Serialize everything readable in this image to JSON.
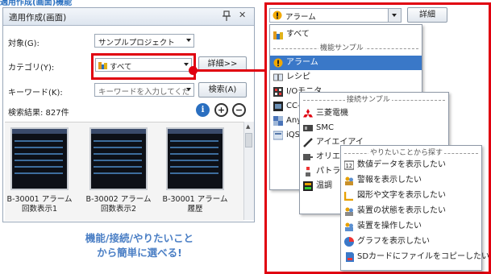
{
  "top_heading": "適用作成(画面)機能",
  "panel": {
    "title": "適用作成(画面)",
    "pin": "ᵖ",
    "close": "✕",
    "target_label": "対象(G):",
    "target_value": "サンプルプロジェクト",
    "category_label": "カテゴリ(Y):",
    "category_value": "すべて",
    "detail_button": "詳細>>",
    "keyword_label": "キーワード(K):",
    "keyword_placeholder": "キーワードを入力してくだ",
    "search_button": "検索(A)",
    "result_label": "検索結果: 827件",
    "info_glyph": "i",
    "zoom_in_glyph": "+",
    "zoom_out_glyph": "−",
    "thumbnails": [
      {
        "caption1": "B-30001 アラーム",
        "caption2": "回数表示1"
      },
      {
        "caption1": "B-30002 アラーム",
        "caption2": "回数表示2"
      },
      {
        "caption1": "B-30001 アラーム",
        "caption2": "履歴"
      }
    ]
  },
  "promo": {
    "line1": "機能/接続/やりたいこと",
    "line2": "から簡単に選べる!"
  },
  "menu": {
    "combo_value": "アラーム",
    "detail_button": "詳細",
    "level1": {
      "all": "すべて",
      "group_label": "機能サンプル",
      "items": [
        "アラーム",
        "レシピ",
        "I/Oモニタ",
        "CC-Link",
        "Any",
        "iQSS"
      ]
    },
    "level2": {
      "group_label": "接続サンプル",
      "items": [
        "三菱電機",
        "SMC",
        "アイエイアイ",
        "オリエンタルモーター",
        "パトライト",
        "温調"
      ]
    },
    "level3": {
      "group_label": "やりたいことから探す",
      "items": [
        "数値データを表示したい",
        "警報を表示したい",
        "図形や文字を表示したい",
        "装置の状態を表示したい",
        "装置を操作したい",
        "グラフを表示したい",
        "SDカードにファイルをコピーしたい"
      ]
    }
  },
  "colors": {
    "accent_red": "#e00010",
    "selected_blue": "#3a78c8",
    "promo_blue": "#4b7fc5"
  }
}
